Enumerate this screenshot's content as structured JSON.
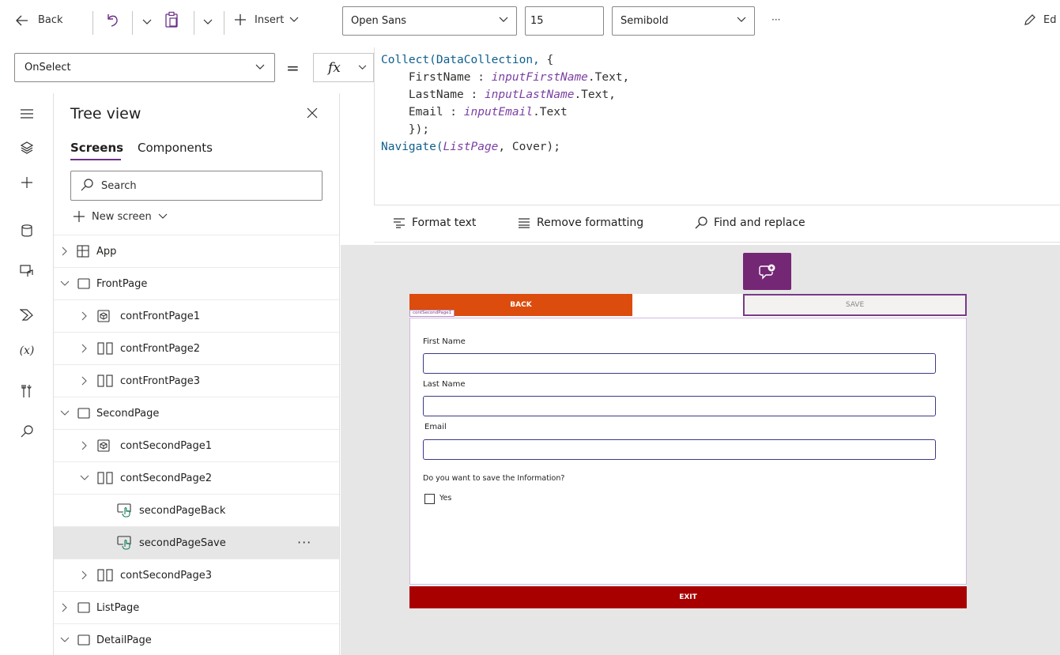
{
  "toolbar": {
    "back_label": "Back",
    "insert_label": "Insert",
    "font_family": "Open Sans",
    "font_size": "15",
    "font_weight": "Semibold",
    "more_label": "···",
    "edit_label": "Ed"
  },
  "formula": {
    "property": "OnSelect",
    "equals": "=",
    "fx": "fx",
    "code_lines": {
      "l1_fn": "Collect(DataCollection,",
      "l1_rest": " {",
      "l2_key": "    FirstName : ",
      "l2_id": "inputFirstName",
      "l2_rest": ".Text,",
      "l3_key": "    LastName : ",
      "l3_id": "inputLastName",
      "l3_rest": ".Text,",
      "l4_key": "    Email : ",
      "l4_id": "inputEmail",
      "l4_rest": ".Text",
      "l5": "    });",
      "l6_fn": "Navigate(",
      "l6_id": "ListPage",
      "l6_rest": ", Cover);"
    },
    "format_text": "Format text",
    "remove_formatting": "Remove formatting",
    "find_replace": "Find and replace"
  },
  "tree": {
    "title": "Tree view",
    "tab_screens": "Screens",
    "tab_components": "Components",
    "search_placeholder": "Search",
    "new_screen": "New screen",
    "rows": [
      {
        "label": "App"
      },
      {
        "label": "FrontPage"
      },
      {
        "label": "contFrontPage1"
      },
      {
        "label": "contFrontPage2"
      },
      {
        "label": "contFrontPage3"
      },
      {
        "label": "SecondPage"
      },
      {
        "label": "contSecondPage1"
      },
      {
        "label": "contSecondPage2"
      },
      {
        "label": "secondPageBack"
      },
      {
        "label": "secondPageSave"
      },
      {
        "label": "contSecondPage3"
      },
      {
        "label": "ListPage"
      },
      {
        "label": "DetailPage"
      }
    ],
    "more": "···"
  },
  "canvas": {
    "back_button": "BACK",
    "save_button": "SAVE",
    "container_tag": "contSecondPage1",
    "first_name_label": "First Name",
    "last_name_label": "Last Name",
    "email_label": "Email",
    "question": "Do you want to save the Information?",
    "yes_label": "Yes",
    "exit_button": "EXIT"
  },
  "colors": {
    "accent_purple": "#742774",
    "back_orange": "#dc4c0d",
    "exit_red": "#a80000"
  }
}
